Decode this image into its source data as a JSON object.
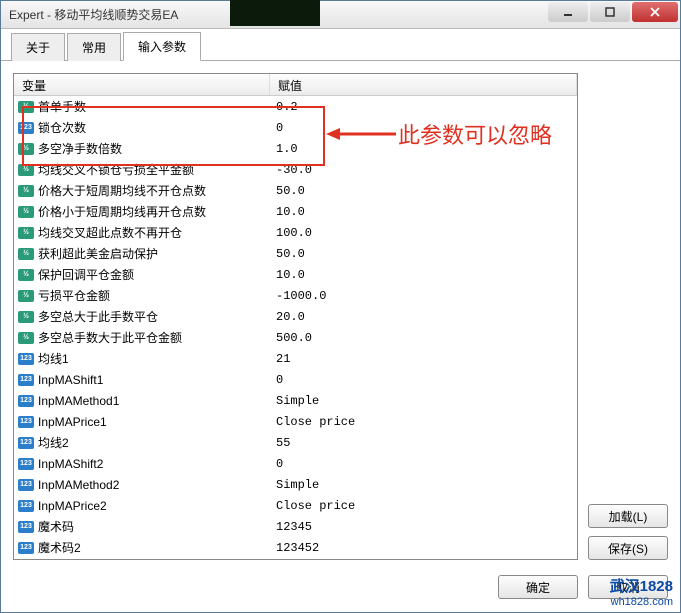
{
  "window": {
    "title": "Expert - 移动平均线顺势交易EA"
  },
  "tabs": {
    "about": "关于",
    "common": "常用",
    "input": "输入参数"
  },
  "grid": {
    "header_var": "变量",
    "header_val": "赋值",
    "rows": [
      {
        "type": "dbl",
        "name": "首单手数",
        "value": "0.2"
      },
      {
        "type": "int",
        "name": "锁仓次数",
        "value": "0"
      },
      {
        "type": "dbl",
        "name": "多空净手数倍数",
        "value": "1.0"
      },
      {
        "type": "dbl",
        "name": "均线交叉不锁仓亏损全平金额",
        "value": "-30.0"
      },
      {
        "type": "dbl",
        "name": "价格大于短周期均线不开仓点数",
        "value": "50.0"
      },
      {
        "type": "dbl",
        "name": "价格小于短周期均线再开仓点数",
        "value": "10.0"
      },
      {
        "type": "dbl",
        "name": "均线交叉超此点数不再开仓",
        "value": "100.0"
      },
      {
        "type": "dbl",
        "name": "获利超此美金启动保护",
        "value": "50.0"
      },
      {
        "type": "dbl",
        "name": "保护回调平仓金额",
        "value": "10.0"
      },
      {
        "type": "dbl",
        "name": "亏损平仓金额",
        "value": "-1000.0"
      },
      {
        "type": "dbl",
        "name": "多空总大于此手数平仓",
        "value": "20.0"
      },
      {
        "type": "dbl",
        "name": "多空总手数大于此平仓金额",
        "value": "500.0"
      },
      {
        "type": "int",
        "name": "均线1",
        "value": "21"
      },
      {
        "type": "int",
        "name": "InpMAShift1",
        "value": "0"
      },
      {
        "type": "int",
        "name": "InpMAMethod1",
        "value": "Simple"
      },
      {
        "type": "int",
        "name": "InpMAPrice1",
        "value": "Close price"
      },
      {
        "type": "int",
        "name": "均线2",
        "value": "55"
      },
      {
        "type": "int",
        "name": "InpMAShift2",
        "value": "0"
      },
      {
        "type": "int",
        "name": "InpMAMethod2",
        "value": "Simple"
      },
      {
        "type": "int",
        "name": "InpMAPrice2",
        "value": "Close price"
      },
      {
        "type": "int",
        "name": "魔术码",
        "value": "12345"
      },
      {
        "type": "int",
        "name": "魔术码2",
        "value": "123452"
      }
    ]
  },
  "side_buttons": {
    "load": "加载(L)",
    "save": "保存(S)"
  },
  "footer": {
    "ok": "确定",
    "cancel": "取消"
  },
  "annotation": {
    "text": "此参数可以忽略"
  },
  "watermark": {
    "line1": "武汉1828",
    "line2": "wh1828.com"
  },
  "type_labels": {
    "dbl": "½",
    "int": "123"
  }
}
